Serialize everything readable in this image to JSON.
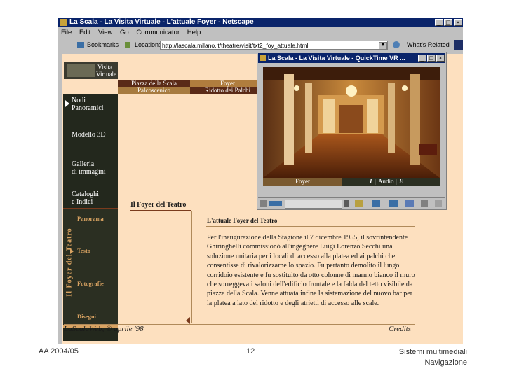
{
  "browser": {
    "title": "La Scala - La Visita Virtuale - L'attuale Foyer - Netscape",
    "menu": [
      "File",
      "Edit",
      "View",
      "Go",
      "Communicator",
      "Help"
    ],
    "bookmarks_label": "Bookmarks",
    "location_label": "Location:",
    "url": "http://lascala.milano.it/theatre/visit/txt2_foy_attuale.html",
    "whats_related": "What's Related"
  },
  "site": {
    "logo_line1": "Visita",
    "logo_line2": "Virtuale",
    "tabs": [
      "Piazza della Scala",
      "Foyer",
      "Palcoscenico",
      "Ridotto dei Palchi"
    ],
    "nav": [
      {
        "line1": "Nodi",
        "line2": "Panoramici"
      },
      {
        "line1": "Modello 3D",
        "line2": ""
      },
      {
        "line1": "Galleria",
        "line2": "di immagini"
      },
      {
        "line1": "Cataloghi",
        "line2": "e Indici"
      }
    ],
    "section_vertical": "Il Foyer del Teatro",
    "subnav": [
      "Panorama",
      "Testo",
      "Fotografie",
      "Disegni"
    ],
    "section_title": "Il Foyer del Teatro",
    "article_title": "L'attuale Foyer del Teatro",
    "article_text": "Per l'inaugurazione della Stagione il 7 dicembre 1955, il sovrintendente Ghiringhelli commissionò all'ingegnere Luigi Lorenzo Secchi una soluzione unitaria per i locali di accesso alla platea ed ai palchi che consentisse di rivalorizzarne lo spazio. Fu pertanto demolito il lungo corridoio esistente e fu sostituito da otto colonne di marmo bianco il muro che sorreggeva i saloni dell'edificio frontale e la falda del tetto visibile da piazza della Scala. Venne attuata infine la sistemazione del nuovo bar per la platea a lato del ridotto e degli atrietti di accesso alle scale.",
    "footer_link": "LaScalaWeb",
    "footer_date": ", © aprile '98",
    "credits": "Credits"
  },
  "quicktime": {
    "title": "La Scala - La Visita Virtuale - QuickTime VR ...",
    "caption_left": "Foyer",
    "caption_i": "I",
    "caption_audio": "Audio",
    "caption_e": "E"
  },
  "slide": {
    "left": "AA 2004/05",
    "center": "12",
    "right_line1": "Sistemi multimediali",
    "right_line2": "Navigazione"
  },
  "colors": {
    "title_bar": "#0a246a",
    "page_bg": "#fde0bf",
    "nav_bg": "#23281d",
    "accent": "#d9a362",
    "tab_brown": "#7a3b1d"
  }
}
